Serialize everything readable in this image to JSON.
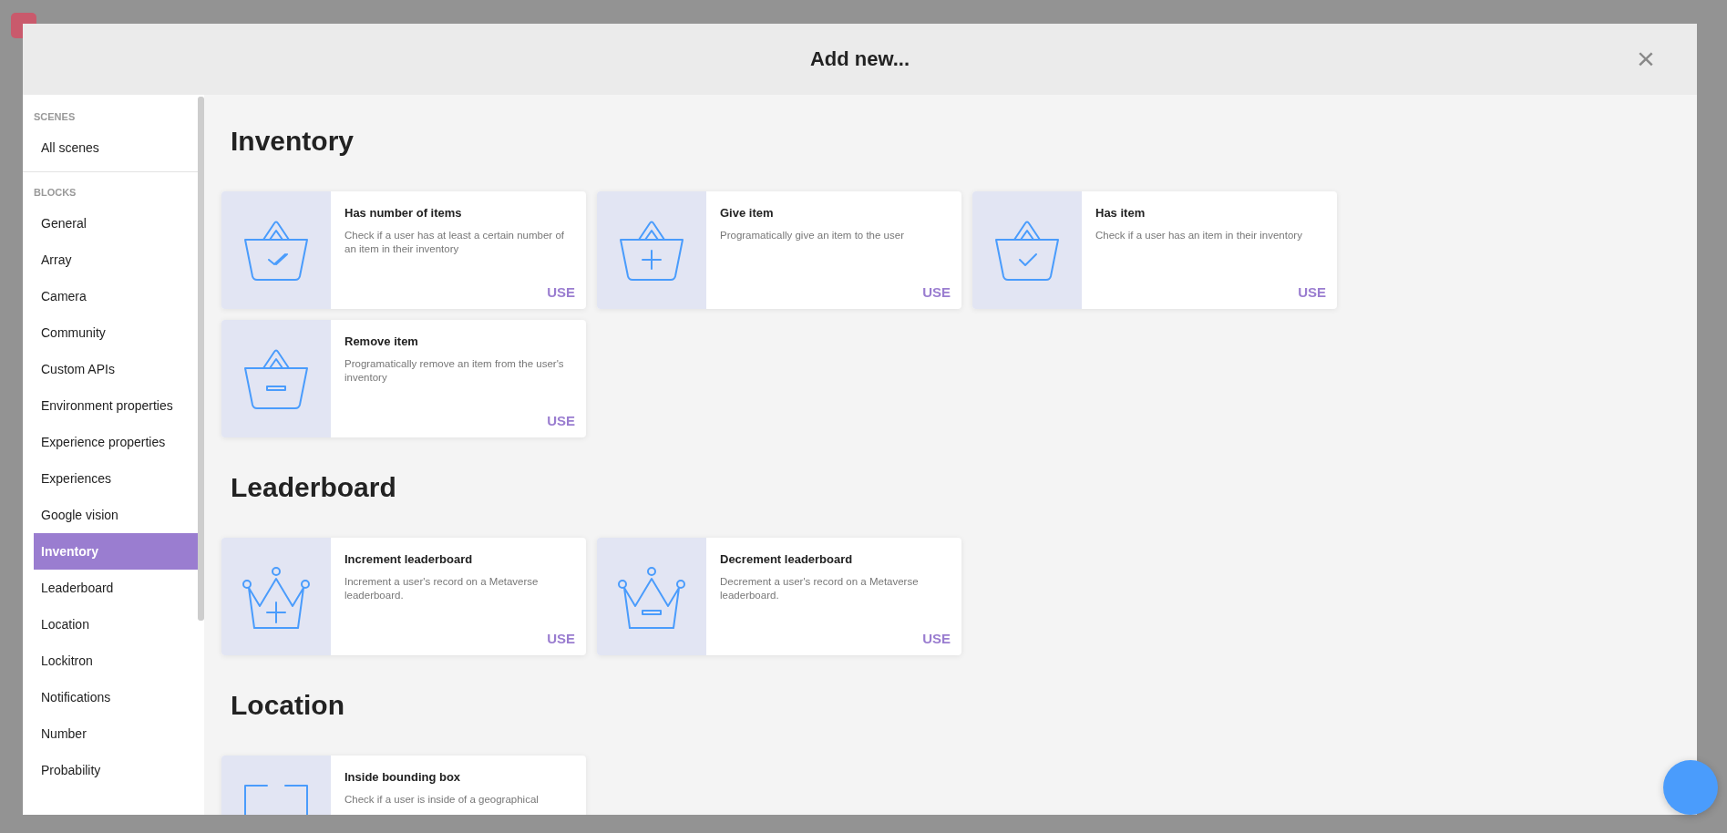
{
  "modal": {
    "title": "Add new...",
    "close": "×"
  },
  "sidebar": [
    {
      "heading": "SCENES",
      "items": [
        {
          "label": "All scenes",
          "selected": false
        }
      ]
    },
    {
      "heading": "BLOCKS",
      "items": [
        {
          "label": "General",
          "selected": false
        },
        {
          "label": "Array",
          "selected": false
        },
        {
          "label": "Camera",
          "selected": false
        },
        {
          "label": "Community",
          "selected": false
        },
        {
          "label": "Custom APIs",
          "selected": false
        },
        {
          "label": "Environment properties",
          "selected": false
        },
        {
          "label": "Experience properties",
          "selected": false
        },
        {
          "label": "Experiences",
          "selected": false
        },
        {
          "label": "Google vision",
          "selected": false
        },
        {
          "label": "Inventory",
          "selected": true
        },
        {
          "label": "Leaderboard",
          "selected": false
        },
        {
          "label": "Location",
          "selected": false
        },
        {
          "label": "Lockitron",
          "selected": false
        },
        {
          "label": "Notifications",
          "selected": false
        },
        {
          "label": "Number",
          "selected": false
        },
        {
          "label": "Probability",
          "selected": false
        }
      ]
    }
  ],
  "sections": [
    {
      "title": "Inventory",
      "cards": [
        {
          "kind": "basket_double_check",
          "title": "Has number of items",
          "description": "Check if a user has at least a certain number of an item in their inventory",
          "action": "USE"
        },
        {
          "kind": "basket_plus",
          "title": "Give item",
          "description": "Programatically give an item to the user",
          "action": "USE"
        },
        {
          "kind": "basket_check",
          "title": "Has item",
          "description": "Check if a user has an item in their inventory",
          "action": "USE"
        },
        {
          "kind": "basket_minus",
          "title": "Remove item",
          "description": "Programatically remove an item from the user's inventory",
          "action": "USE"
        }
      ]
    },
    {
      "title": "Leaderboard",
      "cards": [
        {
          "kind": "crown_plus",
          "title": "Increment leaderboard",
          "description": "Increment a user's record on a Metaverse leaderboard.",
          "action": "USE"
        },
        {
          "kind": "crown_minus",
          "title": "Decrement leaderboard",
          "description": "Decrement a user's record on a Metaverse leaderboard.",
          "action": "USE"
        }
      ]
    },
    {
      "title": "Location",
      "cards": [
        {
          "kind": "bounding_box",
          "title": "Inside bounding box",
          "description": "Check if a user is inside of a geographical"
        }
      ]
    }
  ]
}
